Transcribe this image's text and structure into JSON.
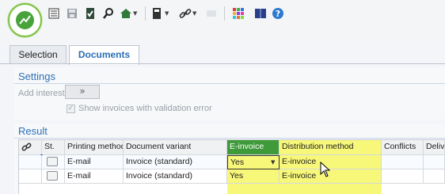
{
  "toolbar": {
    "icons": [
      "app-logo-icon",
      "list-icon",
      "save-icon",
      "approve-document-icon",
      "search-icon",
      "home-icon",
      "print-icon",
      "link-icon",
      "disabled-icon",
      "color-palette-icon",
      "book-icon",
      "help-icon"
    ]
  },
  "tabs": [
    {
      "label": "Selection",
      "active": false
    },
    {
      "label": "Documents",
      "active": true
    }
  ],
  "settings": {
    "title": "Settings",
    "add_interest_label": "Add interest",
    "add_interest_button": "»",
    "show_invoices_label": "Show invoices with validation error",
    "show_invoices_checked": true
  },
  "result": {
    "title": "Result",
    "columns": [
      "St.",
      "Printing method",
      "Document variant",
      "E-invoice",
      "Distribution method",
      "Conflicts",
      "Delive"
    ],
    "rows": [
      {
        "printing_method": "E-mail",
        "document_variant": "Invoice (standard)",
        "e_invoice": "Yes",
        "distribution_method": "E-invoice"
      },
      {
        "printing_method": "E-mail",
        "document_variant": "Invoice (standard)",
        "e_invoice": "Yes",
        "distribution_method": "E-invoice"
      }
    ]
  },
  "colors": {
    "accent_blue": "#2a6fb5",
    "highlight_yellow": "#f7f77a",
    "header_green": "#3f9a3a",
    "logo_green": "#47a33a"
  }
}
